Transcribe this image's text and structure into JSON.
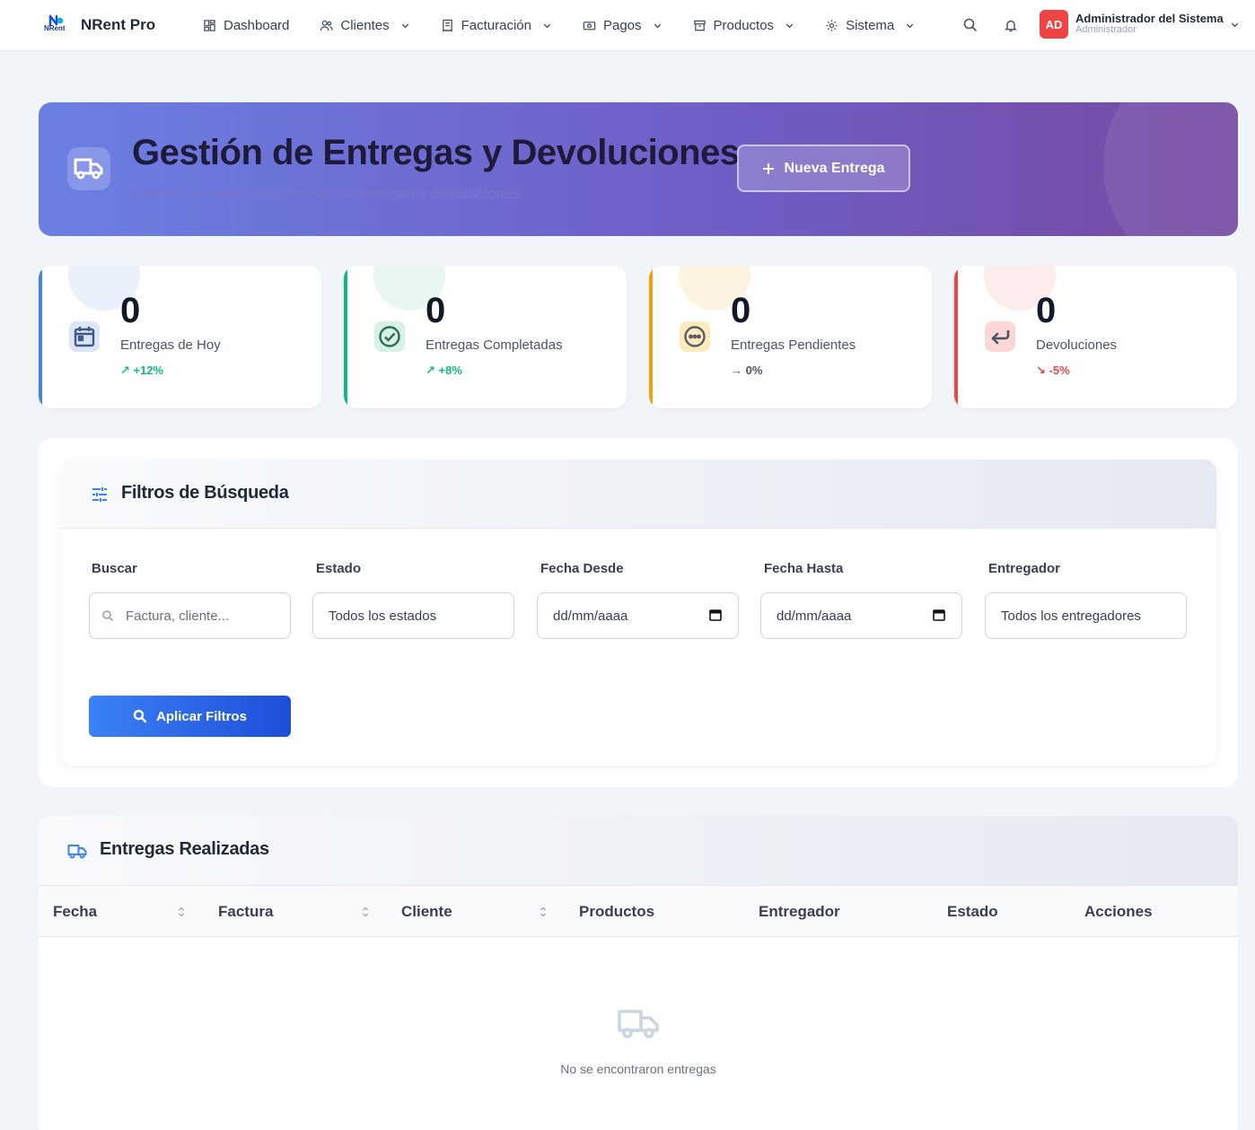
{
  "app": {
    "name": "NRent Pro",
    "logo_text": "NRent"
  },
  "nav": {
    "items": [
      {
        "label": "Dashboard",
        "icon": "grid-icon"
      },
      {
        "label": "Clientes",
        "icon": "users-icon"
      },
      {
        "label": "Facturación",
        "icon": "receipt-icon"
      },
      {
        "label": "Pagos",
        "icon": "cash-icon"
      },
      {
        "label": "Productos",
        "icon": "box-icon"
      },
      {
        "label": "Sistema",
        "icon": "gear-icon"
      }
    ]
  },
  "user": {
    "initials": "AD",
    "name": "Administrador del Sistema",
    "role": "Administrador"
  },
  "hero": {
    "title": "Gestión de Entregas y Devoluciones",
    "subtitle": "Control completo del proceso de entregas y devoluciones",
    "button_label": "Nueva Entrega"
  },
  "stats": [
    {
      "value": "0",
      "label": "Entregas de Hoy",
      "trend": "↗ +12%",
      "color": "#3b82f6"
    },
    {
      "value": "0",
      "label": "Entregas Completadas",
      "trend": "↗ +8%",
      "color": "#10b981"
    },
    {
      "value": "0",
      "label": "Entregas Pendientes",
      "trend": "→ 0%",
      "color": "#f59e0b"
    },
    {
      "value": "0",
      "label": "Devoluciones",
      "trend": "↘ -5%",
      "color": "#ef4444"
    }
  ],
  "filters": {
    "title": "Filtros de Búsqueda",
    "search": {
      "label": "Buscar",
      "placeholder": "Factura, cliente..."
    },
    "status": {
      "label": "Estado",
      "value": "Todos los estados"
    },
    "date_from": {
      "label": "Fecha Desde",
      "value": "dd/mm/aaaa"
    },
    "date_to": {
      "label": "Fecha Hasta",
      "value": "dd/mm/aaaa"
    },
    "deliverer": {
      "label": "Entregador",
      "value": "Todos los entregadores"
    },
    "apply_label": "Aplicar Filtros"
  },
  "table": {
    "title": "Entregas Realizadas",
    "columns": [
      "Fecha",
      "Factura",
      "Cliente",
      "Productos",
      "Entregador",
      "Estado",
      "Acciones"
    ],
    "empty_message": "No se encontraron entregas"
  }
}
